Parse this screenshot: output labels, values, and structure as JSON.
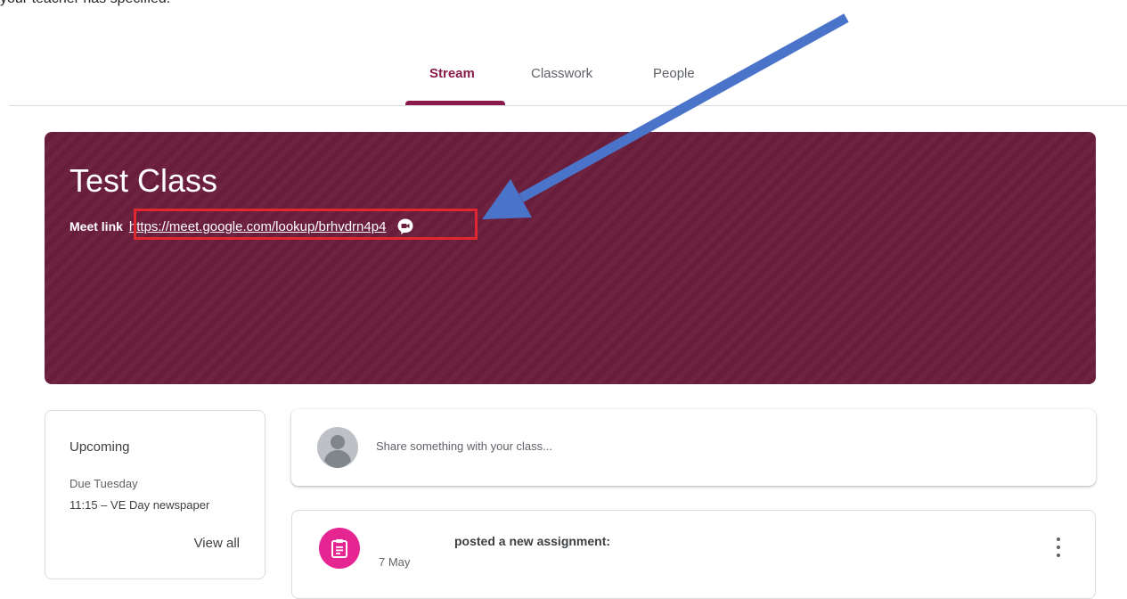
{
  "caption": "your teacher has specified.",
  "tabs": [
    {
      "label": "Stream",
      "active": true
    },
    {
      "label": "Classwork",
      "active": false
    },
    {
      "label": "People",
      "active": false
    }
  ],
  "banner": {
    "class_name": "Test Class",
    "meet_label": "Meet link",
    "meet_url": "https://meet.google.com/lookup/brhvdrn4p4",
    "color": "#6b1e3c"
  },
  "upcoming": {
    "title": "Upcoming",
    "due": "Due Tuesday",
    "item": "11:15 – VE Day newspaper",
    "view_all": "View all"
  },
  "share": {
    "placeholder": "Share something with your class..."
  },
  "post": {
    "text": "posted a new assignment:",
    "date": "7 May",
    "icon": "assignment-icon"
  },
  "colors": {
    "accent": "#8b1a4a",
    "highlight": "#e0262e",
    "arrow": "#4a74c9",
    "assignment": "#e52592"
  }
}
